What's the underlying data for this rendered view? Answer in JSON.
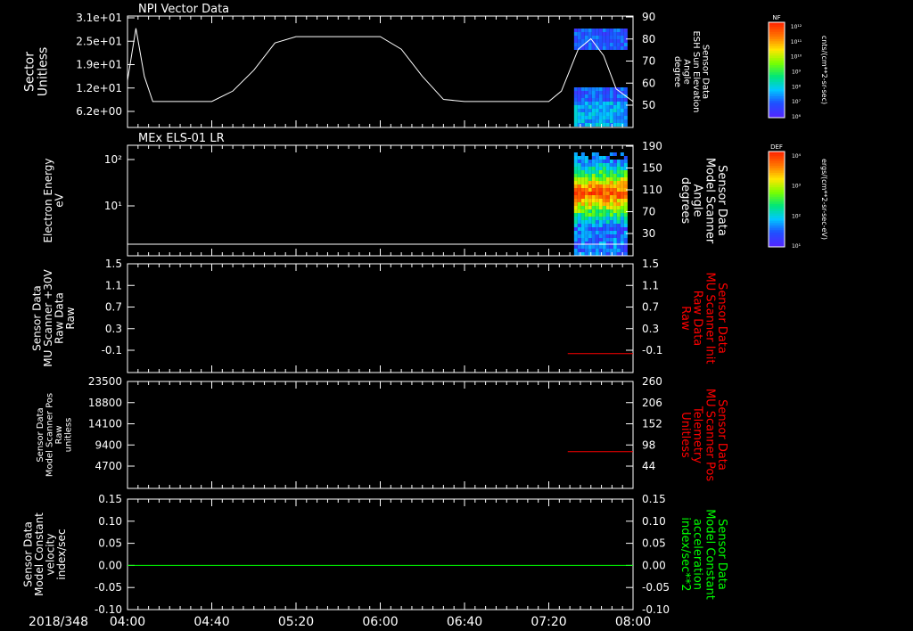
{
  "time_axis": {
    "date": "2018/348",
    "ticks": [
      "04:00",
      "04:40",
      "05:20",
      "06:00",
      "06:40",
      "07:20",
      "08:00"
    ]
  },
  "colorbars": [
    {
      "title": "NF",
      "unit": "cnts/(cm**2-sr-sec)",
      "tick_labels": [
        "10¹²",
        "10¹¹",
        "10¹⁰",
        "10⁹",
        "10⁸",
        "10⁷",
        "10⁶"
      ]
    },
    {
      "title": "DEF",
      "unit": "ergs/(cm**2-sr-sec-eV)",
      "tick_labels": [
        "10⁴",
        "10³",
        "10²",
        "10¹"
      ]
    }
  ],
  "colors": {
    "axis": "#ffffff",
    "series_red": "#ff0000",
    "series_green": "#00ff00",
    "spectrogram_low": "#3a20ff",
    "spectrogram_high": "#ff3000"
  },
  "chart_data": [
    {
      "type": "heatmap",
      "title": "NPI Vector Data",
      "ylabel": "Sector\nUnitless",
      "yticks": [
        "3.1e+01",
        "2.5e+01",
        "1.9e+01",
        "1.2e+01",
        "6.2e+00"
      ],
      "y2label": "Sensor Data\nESH Sun Elevation\nAngle\ndegree",
      "y2ticks": [
        "90",
        "80",
        "70",
        "60",
        "50"
      ],
      "ylim2": [
        41,
        90
      ],
      "line_series": {
        "x": [
          "04:00",
          "04:04",
          "04:08",
          "04:12",
          "04:20",
          "04:40",
          "04:50",
          "05:00",
          "05:10",
          "05:20",
          "05:30",
          "05:40",
          "05:50",
          "06:00",
          "06:10",
          "06:20",
          "06:30",
          "06:40",
          "06:50",
          "07:00",
          "07:10",
          "07:20",
          "07:26",
          "07:34",
          "07:40",
          "07:46",
          "07:52",
          "08:00"
        ],
        "y": [
          60,
          85,
          62,
          50,
          50,
          50,
          55,
          65,
          78,
          81,
          81,
          81,
          81,
          81,
          75,
          62,
          51,
          50,
          50,
          50,
          50,
          50,
          55,
          75,
          80,
          72,
          56,
          50
        ]
      },
      "spectrogram_x_range": [
        "07:32",
        "07:56"
      ]
    },
    {
      "type": "heatmap",
      "title": "MEx ELS-01 LR",
      "ylabel": "Electron Energy\neV",
      "yticks": [
        "10²",
        "10¹"
      ],
      "y2label": "Sensor Data\nModel Scanner\nAngle\ndegrees",
      "y2ticks": [
        "190",
        "150",
        "110",
        "70",
        "30"
      ],
      "ylim2": [
        0,
        190
      ],
      "baseline_label": "",
      "spectrogram_x_range": [
        "07:32",
        "07:56"
      ]
    },
    {
      "type": "line",
      "ylabel": "Sensor Data\nMU Scanner +30V\nRaw Data\nRaw",
      "yticks": [
        "1.5",
        "1.1",
        "0.7",
        "0.3",
        "-0.1"
      ],
      "ylim": [
        -0.3,
        1.5
      ],
      "y2label": "Sensor Data\nMU Scanner Init\nRaw Data\nRaw",
      "y2ticks": [
        "1.5",
        "1.1",
        "0.7",
        "0.3",
        "-0.1"
      ],
      "series": [
        {
          "color": "#ff0000",
          "x": [
            "07:29",
            "08:00"
          ],
          "y": [
            -0.05,
            -0.05
          ]
        }
      ]
    },
    {
      "type": "line",
      "ylabel": "Sensor Data\nModel Scanner Pos\nRaw\nunitless",
      "yticks": [
        "23500",
        "18800",
        "14100",
        "9400",
        "4700"
      ],
      "ylim": [
        0,
        23500
      ],
      "y2label": "Sensor Data\nMU Scanner Pos\nTelemetry\nUnitless",
      "y2ticks": [
        "260",
        "206",
        "152",
        "98",
        "44"
      ],
      "ylim2": [
        0,
        260
      ],
      "series": [
        {
          "color": "#ff0000",
          "axis": "right",
          "x": [
            "07:29",
            "08:00"
          ],
          "y": [
            82,
            82
          ]
        }
      ]
    },
    {
      "type": "line",
      "ylabel": "Sensor Data\nModel Constant\nvelocity\nindex/sec",
      "yticks": [
        "0.15",
        "0.10",
        "0.05",
        "0.00",
        "-0.05",
        "-0.10"
      ],
      "ylim": [
        -0.1,
        0.15
      ],
      "y2label": "Sensor Data\nModel Constant\nacceleration\nindex/sec**2",
      "y2ticks": [
        "0.15",
        "0.10",
        "0.05",
        "0.00",
        "-0.05",
        "-0.10"
      ],
      "series": [
        {
          "color": "#00ff00",
          "x": [
            "04:00",
            "08:00"
          ],
          "y": [
            0.0,
            0.0
          ]
        }
      ]
    }
  ]
}
